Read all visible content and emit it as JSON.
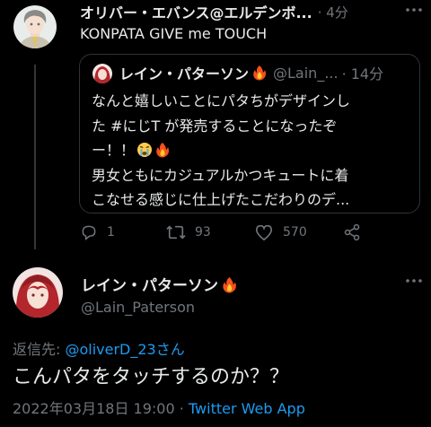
{
  "tweet1": {
    "name": "オリバー・エバンス@エルデンボ...",
    "time": "· 4分",
    "text": "KONPATA GIVE me TOUCH",
    "actions": {
      "reply_count": "1",
      "retweet_count": "93",
      "like_count": "570"
    }
  },
  "quote": {
    "name": "レイン・パターソン",
    "handle": "@Lain_...",
    "time": "· 14分",
    "line1": "なんと嬉しいことにパタちがデザインし",
    "line2": "た #にじT が発売することになったぞ",
    "line3": "ー！！",
    "line4": "男女ともにカジュアルかつキュートに着",
    "line5": "こなせる感じに仕上げたこだわりのデ..."
  },
  "tweet2": {
    "name": "レイン・パターソン",
    "handle": "@Lain_Paterson",
    "reply_prefix": "返信先: ",
    "reply_user": "@oliverD_23さん",
    "text": "こんパタをタッチするのか？？",
    "datetime": "2022年03月18日 19:00",
    "separator": " · ",
    "app": "Twitter Web App"
  },
  "icons": [
    "more-icon",
    "fire-icon",
    "crying-face-icon",
    "reply-icon",
    "retweet-icon",
    "like-icon",
    "share-icon"
  ],
  "colors": {
    "background": "#000000",
    "text_primary": "#e7e9ea",
    "text_secondary": "#71767b",
    "link": "#1d9bf0",
    "border": "#2f3336"
  }
}
